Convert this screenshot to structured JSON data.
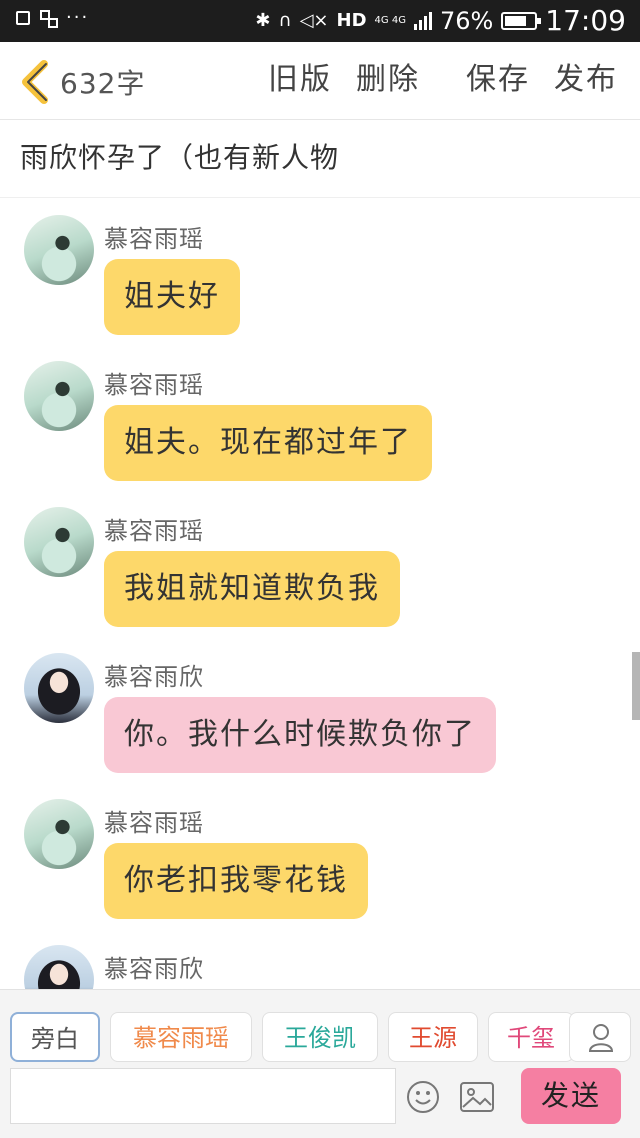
{
  "status_bar": {
    "left_icons": [
      "image-icon",
      "apps-icon",
      "more-dots-icon"
    ],
    "right_icons": [
      "bluetooth-icon",
      "headphones-icon",
      "mute-icon",
      "signal-icon",
      "battery-icon"
    ],
    "hd": "HD",
    "network": "4G 4G",
    "battery_percent_text": "76%",
    "battery_level": 0.76,
    "time": "17:09"
  },
  "toolbar": {
    "word_count": "632字",
    "old_version": "旧版",
    "delete": "删除",
    "save": "保存",
    "publish": "发布"
  },
  "story": {
    "title": "雨欣怀孕了（也有新人物"
  },
  "messages": [
    {
      "sender": "慕容雨瑶",
      "text": "姐夫好",
      "color": "#fdd86a",
      "avatar": "yao"
    },
    {
      "sender": "慕容雨瑶",
      "text": "姐夫。现在都过年了",
      "color": "#fdd86a",
      "avatar": "yao"
    },
    {
      "sender": "慕容雨瑶",
      "text": "我姐就知道欺负我",
      "color": "#fdd86a",
      "avatar": "yao"
    },
    {
      "sender": "慕容雨欣",
      "text": "你。我什么时候欺负你了",
      "color": "#f9c8d4",
      "avatar": "xin"
    },
    {
      "sender": "慕容雨瑶",
      "text": "你老扣我零花钱",
      "color": "#fdd86a",
      "avatar": "yao"
    },
    {
      "sender": "慕容雨欣",
      "text": "",
      "color": "#f9c8d4",
      "avatar": "xin"
    }
  ],
  "roles": [
    {
      "label": "旁白",
      "color": "#555555"
    },
    {
      "label": "慕容雨瑶",
      "color": "#f08a4b"
    },
    {
      "label": "王俊凯",
      "color": "#2aa89a"
    },
    {
      "label": "王源",
      "color": "#e04a2f"
    },
    {
      "label": "千玺",
      "color": "#e0487a"
    }
  ],
  "input": {
    "value": "",
    "placeholder": ""
  },
  "send_label": "发送",
  "colors": {
    "accent_send": "#f57fa2",
    "bubble_yellow": "#fdd86a",
    "bubble_pink": "#f9c8d4"
  }
}
